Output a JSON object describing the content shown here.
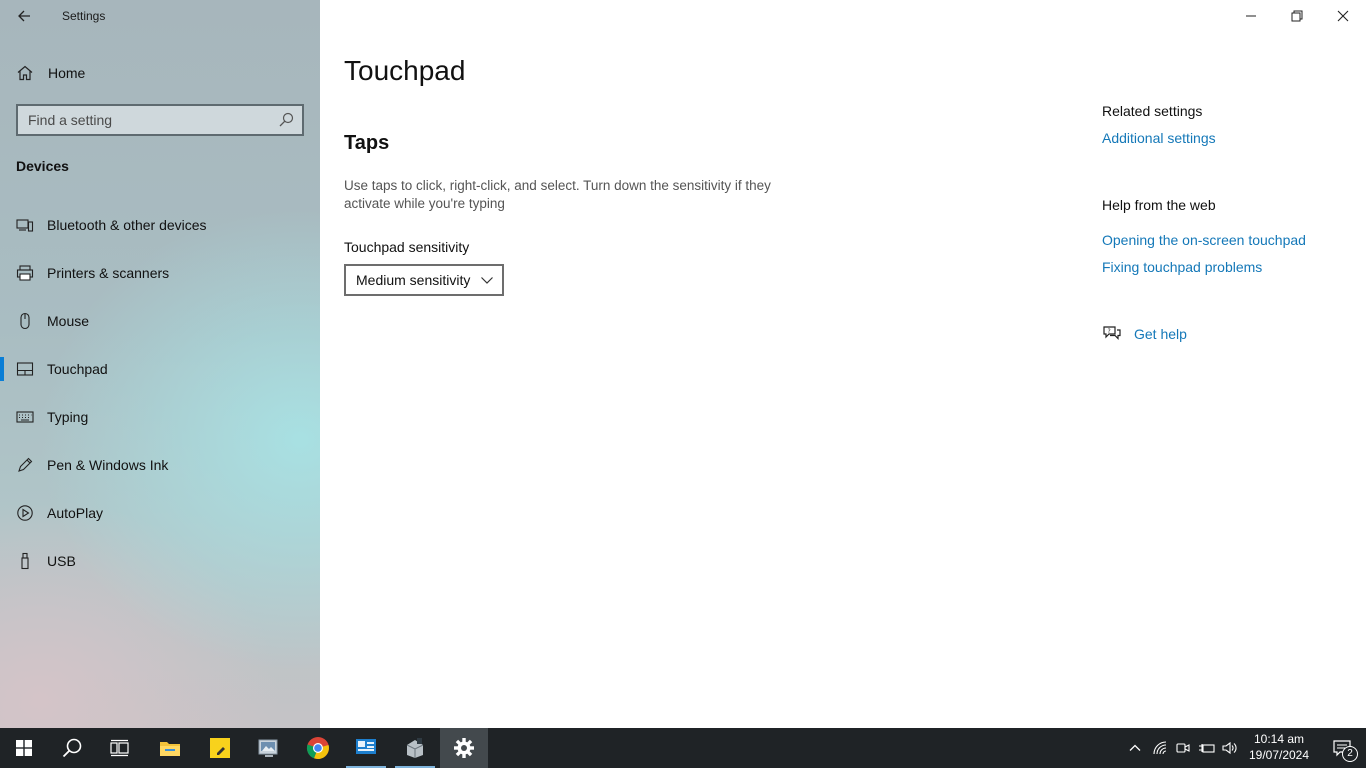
{
  "window": {
    "app_title": "Settings"
  },
  "sidebar": {
    "home_label": "Home",
    "search_placeholder": "Find a setting",
    "section_title": "Devices",
    "items": [
      {
        "label": "Bluetooth & other devices",
        "icon": "bluetooth-devices-icon"
      },
      {
        "label": "Printers & scanners",
        "icon": "printer-icon"
      },
      {
        "label": "Mouse",
        "icon": "mouse-icon"
      },
      {
        "label": "Touchpad",
        "icon": "touchpad-icon",
        "active": true
      },
      {
        "label": "Typing",
        "icon": "keyboard-icon"
      },
      {
        "label": "Pen & Windows Ink",
        "icon": "pen-icon"
      },
      {
        "label": "AutoPlay",
        "icon": "autoplay-icon"
      },
      {
        "label": "USB",
        "icon": "usb-icon"
      }
    ]
  },
  "main": {
    "page_title": "Touchpad",
    "section_title": "Taps",
    "description": "Use taps to click, right-click, and select. Turn down the sensitivity if they activate while you're typing",
    "sensitivity_label": "Touchpad sensitivity",
    "sensitivity_value": "Medium sensitivity"
  },
  "related": {
    "related_title": "Related settings",
    "additional_settings": "Additional settings",
    "help_title": "Help from the web",
    "help_link_1": "Opening the on-screen touchpad",
    "help_link_2": "Fixing touchpad problems",
    "get_help": "Get help"
  },
  "taskbar": {
    "apps": [
      "start",
      "search",
      "task-view",
      "file-explorer",
      "sticky-notes",
      "app",
      "chrome",
      "app",
      "app",
      "settings"
    ],
    "time": "10:14 am",
    "date": "19/07/2024",
    "notification_count": "2"
  },
  "colors": {
    "accent": "#0a7ed6",
    "link": "#1478b8",
    "taskbar": "#1f2326"
  }
}
